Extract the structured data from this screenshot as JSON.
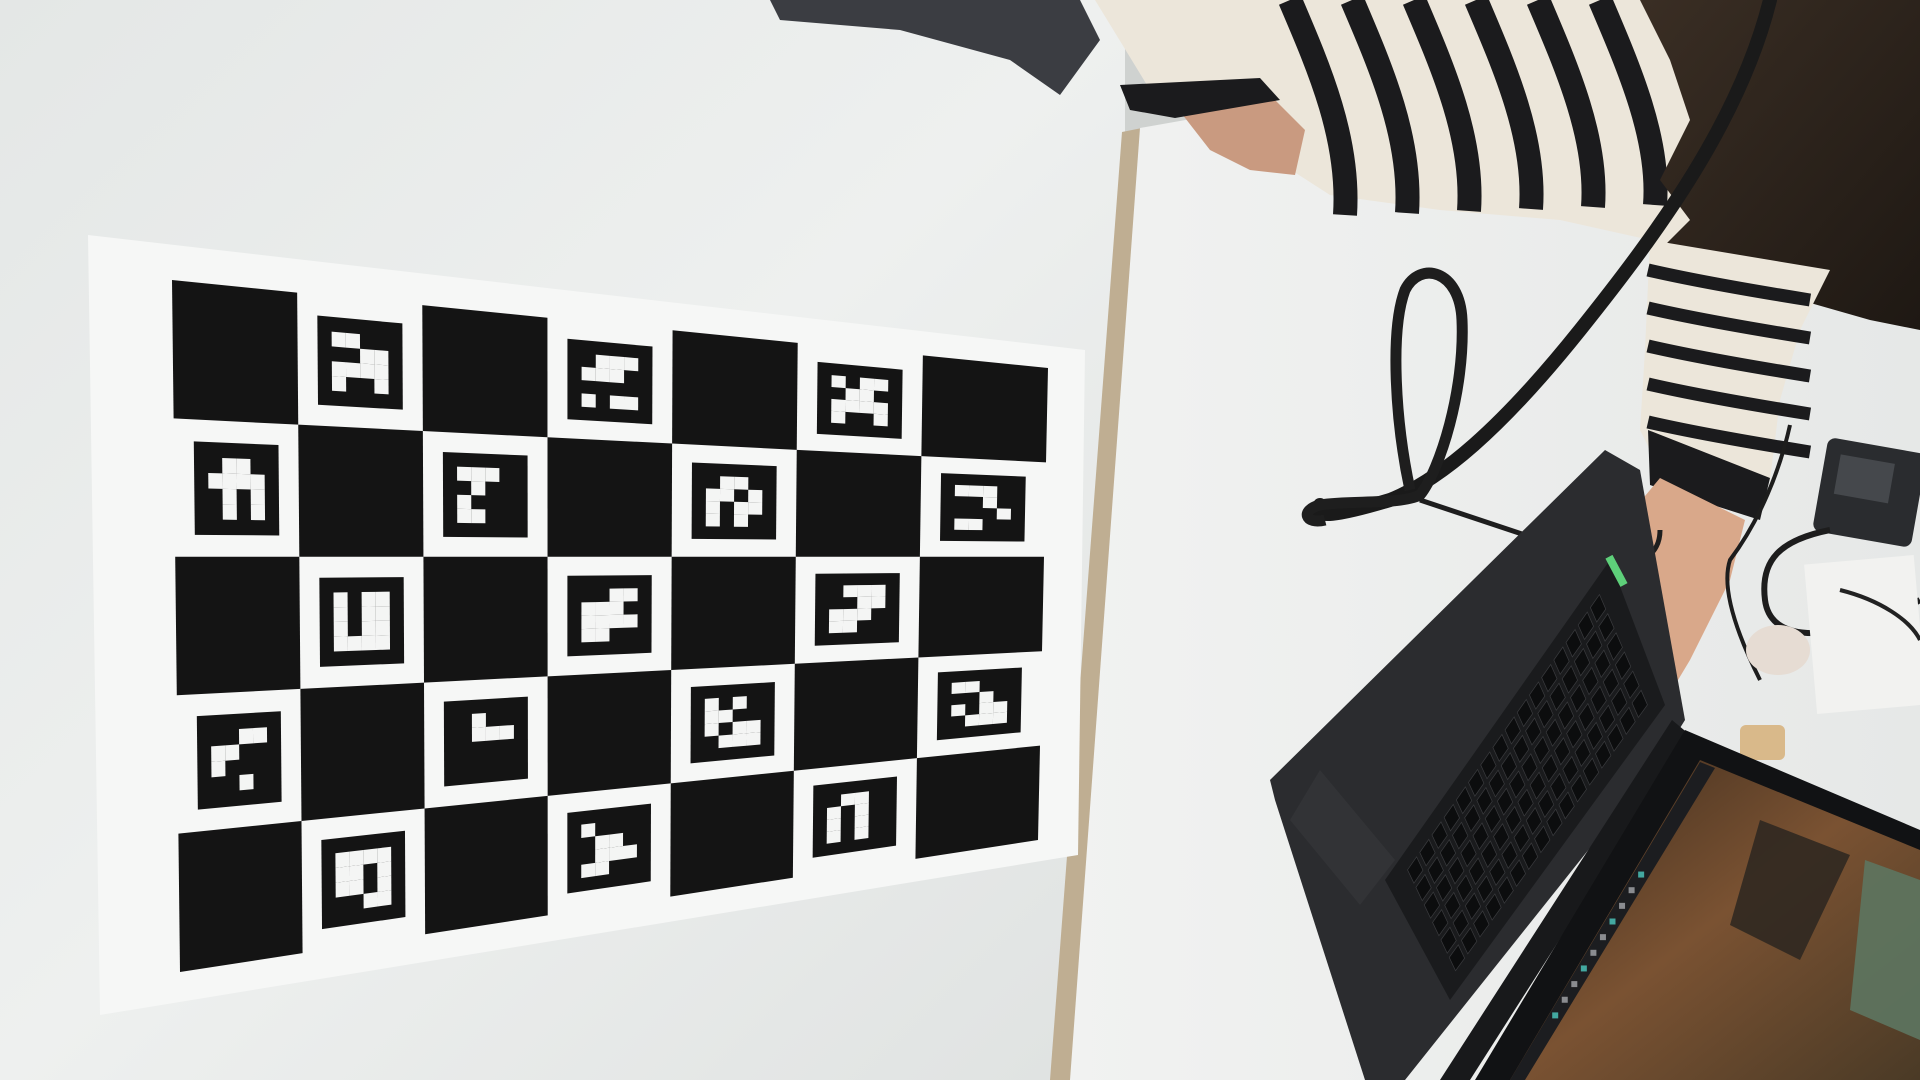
{
  "scene": {
    "description_free": true,
    "colors": {
      "table_white": "#eef0ef",
      "table_shadow": "#c9cdcc",
      "table_edge": "#b8a88f",
      "board_paper": "#f4f5f4",
      "board_black": "#141414",
      "laptop_body": "#262729",
      "laptop_keys": "#101113",
      "laptop_screen_warm": "#6b4a2e",
      "sweater_cream": "#ece6da",
      "sweater_black": "#1b1b1d",
      "hair_dark": "#2a221c",
      "skin": "#d9a88a",
      "cable_black": "#1a1a1a",
      "teal_accent": "#43a8a0"
    },
    "checkerboard": {
      "rows": 5,
      "cols": 7,
      "marker_pattern_seed": [
        [
          0,
          1,
          0,
          1,
          0,
          1,
          0
        ],
        [
          1,
          0,
          1,
          0,
          1,
          0,
          1
        ],
        [
          0,
          1,
          0,
          1,
          0,
          1,
          0
        ],
        [
          1,
          0,
          1,
          0,
          1,
          0,
          1
        ],
        [
          0,
          1,
          0,
          1,
          0,
          1,
          0
        ]
      ]
    }
  }
}
